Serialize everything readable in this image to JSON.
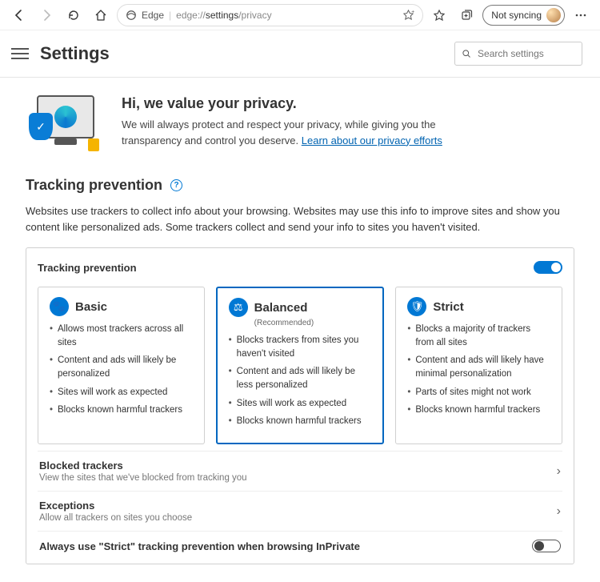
{
  "toolbar": {
    "edge_label": "Edge",
    "url_pre": "edge://",
    "url_mid": "settings",
    "url_post": "/privacy",
    "sync_label": "Not syncing"
  },
  "header": {
    "title": "Settings",
    "search_placeholder": "Search settings"
  },
  "hero": {
    "title": "Hi, we value your privacy.",
    "body": "We will always protect and respect your privacy, while giving you the transparency and control you deserve. ",
    "link": "Learn about our privacy efforts"
  },
  "tracking": {
    "title": "Tracking prevention",
    "desc": "Websites use trackers to collect info about your browsing. Websites may use this info to improve sites and show you content like personalized ads. Some trackers collect and send your info to sites you haven't visited.",
    "panel_title": "Tracking prevention",
    "cards": [
      {
        "title": "Basic",
        "sub": "",
        "bullets": [
          "Allows most trackers across all sites",
          "Content and ads will likely be personalized",
          "Sites will work as expected",
          "Blocks known harmful trackers"
        ]
      },
      {
        "title": "Balanced",
        "sub": "(Recommended)",
        "bullets": [
          "Blocks trackers from sites you haven't visited",
          "Content and ads will likely be less personalized",
          "Sites will work as expected",
          "Blocks known harmful trackers"
        ]
      },
      {
        "title": "Strict",
        "sub": "",
        "bullets": [
          "Blocks a majority of trackers from all sites",
          "Content and ads will likely have minimal personalization",
          "Parts of sites might not work",
          "Blocks known harmful trackers"
        ]
      }
    ],
    "blocked_title": "Blocked trackers",
    "blocked_sub": "View the sites that we've blocked from tracking you",
    "exc_title": "Exceptions",
    "exc_sub": "Allow all trackers on sites you choose",
    "strict_row": "Always use \"Strict\" tracking prevention when browsing InPrivate"
  }
}
